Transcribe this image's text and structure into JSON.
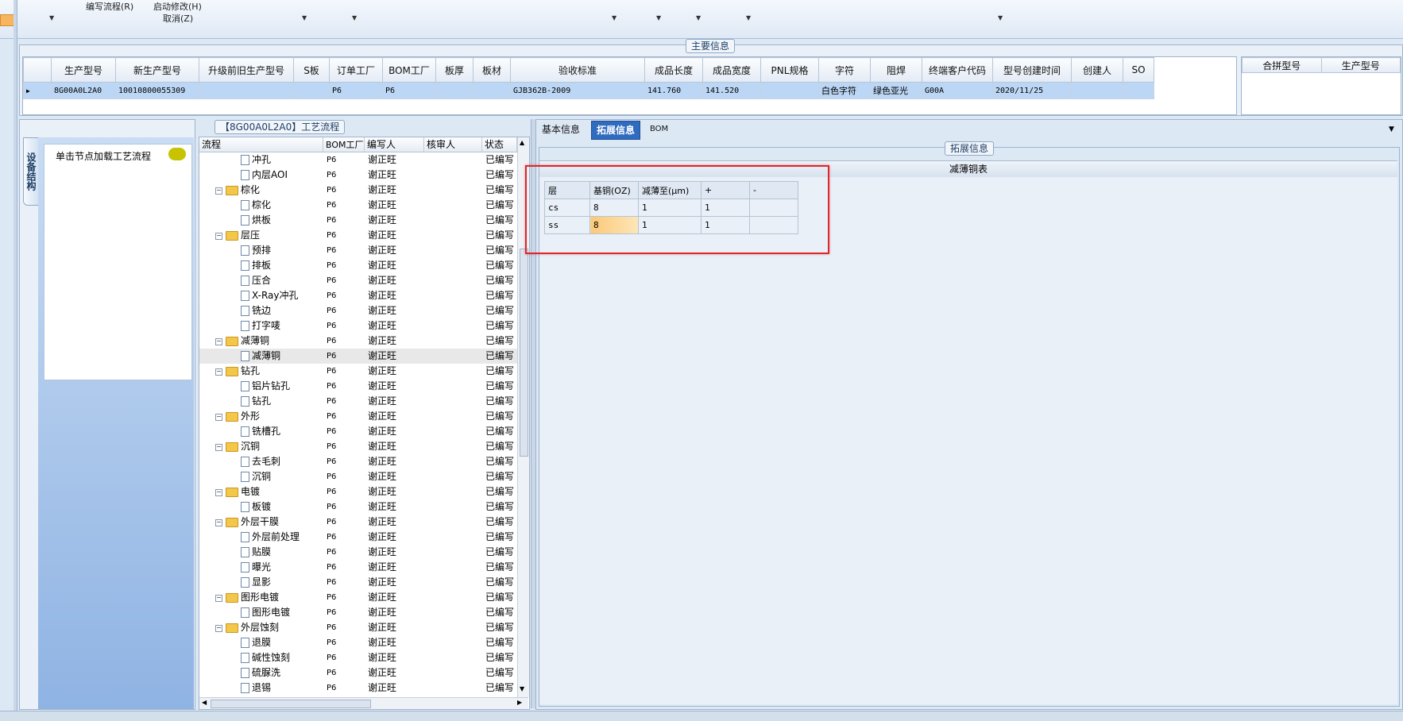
{
  "ribbon": {
    "write_flow": "编写流程(R)",
    "start_edit": "启动修改(H)",
    "cancel": "取消(Z)"
  },
  "main_info": {
    "title": "主要信息",
    "columns": [
      "生产型号",
      "新生产型号",
      "升级前旧生产型号",
      "S板",
      "订单工厂",
      "BOM工厂",
      "板厚",
      "板材",
      "验收标准",
      "成品长度",
      "成品宽度",
      "PNL规格",
      "字符",
      "阻焊",
      "终端客户代码",
      "型号创建时间",
      "创建人",
      "SO"
    ],
    "row": [
      "8G00A0L2A0",
      "10010800055309",
      "",
      "",
      "P6",
      "P6",
      "",
      "",
      "GJB362B-2009",
      "141.760",
      "141.520",
      "",
      "白色字符",
      "绿色亚光",
      "G00A",
      "2020/11/25",
      "",
      ""
    ],
    "side_columns": [
      "合拼型号",
      "生产型号"
    ]
  },
  "left_panel": {
    "vertical_tab": "设备结构",
    "hint": "单击节点加载工艺流程"
  },
  "process": {
    "title": "【8G00A0L2A0】工艺流程",
    "columns": [
      "流程",
      "BOM工厂",
      "编写人",
      "核审人",
      "状态"
    ],
    "rows": [
      {
        "name": "冲孔",
        "level": 2,
        "bom": "P6",
        "writer": "谢正旺",
        "status": "已编写"
      },
      {
        "name": "内层AOI",
        "level": 2,
        "bom": "P6",
        "writer": "谢正旺",
        "status": "已编写"
      },
      {
        "name": "棕化",
        "level": 1,
        "bom": "P6",
        "writer": "谢正旺",
        "status": "已编写"
      },
      {
        "name": "棕化",
        "level": 2,
        "bom": "P6",
        "writer": "谢正旺",
        "status": "已编写"
      },
      {
        "name": "烘板",
        "level": 2,
        "bom": "P6",
        "writer": "谢正旺",
        "status": "已编写"
      },
      {
        "name": "层压",
        "level": 1,
        "bom": "P6",
        "writer": "谢正旺",
        "status": "已编写"
      },
      {
        "name": "预排",
        "level": 2,
        "bom": "P6",
        "writer": "谢正旺",
        "status": "已编写"
      },
      {
        "name": "排板",
        "level": 2,
        "bom": "P6",
        "writer": "谢正旺",
        "status": "已编写"
      },
      {
        "name": "压合",
        "level": 2,
        "bom": "P6",
        "writer": "谢正旺",
        "status": "已编写"
      },
      {
        "name": "X-Ray冲孔",
        "level": 2,
        "bom": "P6",
        "writer": "谢正旺",
        "status": "已编写"
      },
      {
        "name": "铣边",
        "level": 2,
        "bom": "P6",
        "writer": "谢正旺",
        "status": "已编写"
      },
      {
        "name": "打字唛",
        "level": 2,
        "bom": "P6",
        "writer": "谢正旺",
        "status": "已编写"
      },
      {
        "name": "减薄铜",
        "level": 1,
        "bom": "P6",
        "writer": "谢正旺",
        "status": "已编写"
      },
      {
        "name": "减薄铜",
        "level": 2,
        "bom": "P6",
        "writer": "谢正旺",
        "status": "已编写",
        "selected": true
      },
      {
        "name": "钻孔",
        "level": 1,
        "bom": "P6",
        "writer": "谢正旺",
        "status": "已编写"
      },
      {
        "name": "铝片钻孔",
        "level": 2,
        "bom": "P6",
        "writer": "谢正旺",
        "status": "已编写"
      },
      {
        "name": "钻孔",
        "level": 2,
        "bom": "P6",
        "writer": "谢正旺",
        "status": "已编写"
      },
      {
        "name": "外形",
        "level": 1,
        "bom": "P6",
        "writer": "谢正旺",
        "status": "已编写"
      },
      {
        "name": "铣槽孔",
        "level": 2,
        "bom": "P6",
        "writer": "谢正旺",
        "status": "已编写"
      },
      {
        "name": "沉铜",
        "level": 1,
        "bom": "P6",
        "writer": "谢正旺",
        "status": "已编写"
      },
      {
        "name": "去毛刺",
        "level": 2,
        "bom": "P6",
        "writer": "谢正旺",
        "status": "已编写"
      },
      {
        "name": "沉铜",
        "level": 2,
        "bom": "P6",
        "writer": "谢正旺",
        "status": "已编写"
      },
      {
        "name": "电镀",
        "level": 1,
        "bom": "P6",
        "writer": "谢正旺",
        "status": "已编写"
      },
      {
        "name": "板镀",
        "level": 2,
        "bom": "P6",
        "writer": "谢正旺",
        "status": "已编写"
      },
      {
        "name": "外层干膜",
        "level": 1,
        "bom": "P6",
        "writer": "谢正旺",
        "status": "已编写"
      },
      {
        "name": "外层前处理",
        "level": 2,
        "bom": "P6",
        "writer": "谢正旺",
        "status": "已编写"
      },
      {
        "name": "贴膜",
        "level": 2,
        "bom": "P6",
        "writer": "谢正旺",
        "status": "已编写"
      },
      {
        "name": "曝光",
        "level": 2,
        "bom": "P6",
        "writer": "谢正旺",
        "status": "已编写"
      },
      {
        "name": "显影",
        "level": 2,
        "bom": "P6",
        "writer": "谢正旺",
        "status": "已编写"
      },
      {
        "name": "图形电镀",
        "level": 1,
        "bom": "P6",
        "writer": "谢正旺",
        "status": "已编写"
      },
      {
        "name": "图形电镀",
        "level": 2,
        "bom": "P6",
        "writer": "谢正旺",
        "status": "已编写"
      },
      {
        "name": "外层蚀刻",
        "level": 1,
        "bom": "P6",
        "writer": "谢正旺",
        "status": "已编写"
      },
      {
        "name": "退膜",
        "level": 2,
        "bom": "P6",
        "writer": "谢正旺",
        "status": "已编写"
      },
      {
        "name": "碱性蚀刻",
        "level": 2,
        "bom": "P6",
        "writer": "谢正旺",
        "status": "已编写"
      },
      {
        "name": "硫脲洗",
        "level": 2,
        "bom": "P6",
        "writer": "谢正旺",
        "status": "已编写"
      },
      {
        "name": "退锡",
        "level": 2,
        "bom": "P6",
        "writer": "谢正旺",
        "status": "已编写"
      }
    ]
  },
  "tabs": [
    "基本信息",
    "拓展信息",
    "BOM"
  ],
  "active_tab": "拓展信息",
  "ext": {
    "group_title": "拓展信息",
    "table_title": "减薄铜表",
    "headers": [
      "层",
      "基铜(OZ)",
      "减薄至(μm)",
      "+",
      "-"
    ],
    "rows": [
      [
        "cs",
        "8",
        "1",
        "1",
        ""
      ],
      [
        "ss",
        "8",
        "1",
        "1",
        ""
      ]
    ]
  }
}
